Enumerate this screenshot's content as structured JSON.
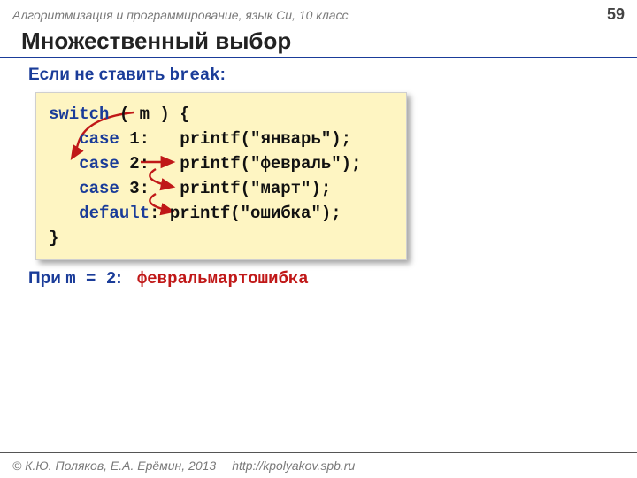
{
  "header": {
    "course": "Алгоритмизация и программирование, язык Си, 10 класс",
    "page": "59"
  },
  "title": "Множественный выбор",
  "subtitle": {
    "prefix": "Если не ставить ",
    "kw": "break",
    "suffix": ":"
  },
  "code": {
    "l1a": "switch",
    "l1b": " ( m ) {",
    "l2a": "   case",
    "l2b": " 1:   printf(\"январь\");",
    "l3a": "   case",
    "l3b": " 2:   printf(\"февраль\");",
    "l4a": "   case",
    "l4b": " 3:   printf(\"март\");",
    "l5a": "   default",
    "l5b": ": printf(\"ошибка\");",
    "l6": "}"
  },
  "result": {
    "prefix": "При ",
    "cond": "m = 2",
    "suffix": ":",
    "output": "февральмартошибка"
  },
  "footer": {
    "copyright": "© К.Ю. Поляков, Е.А. Ерёмин, 2013",
    "url": "http://kpolyakov.spb.ru"
  }
}
